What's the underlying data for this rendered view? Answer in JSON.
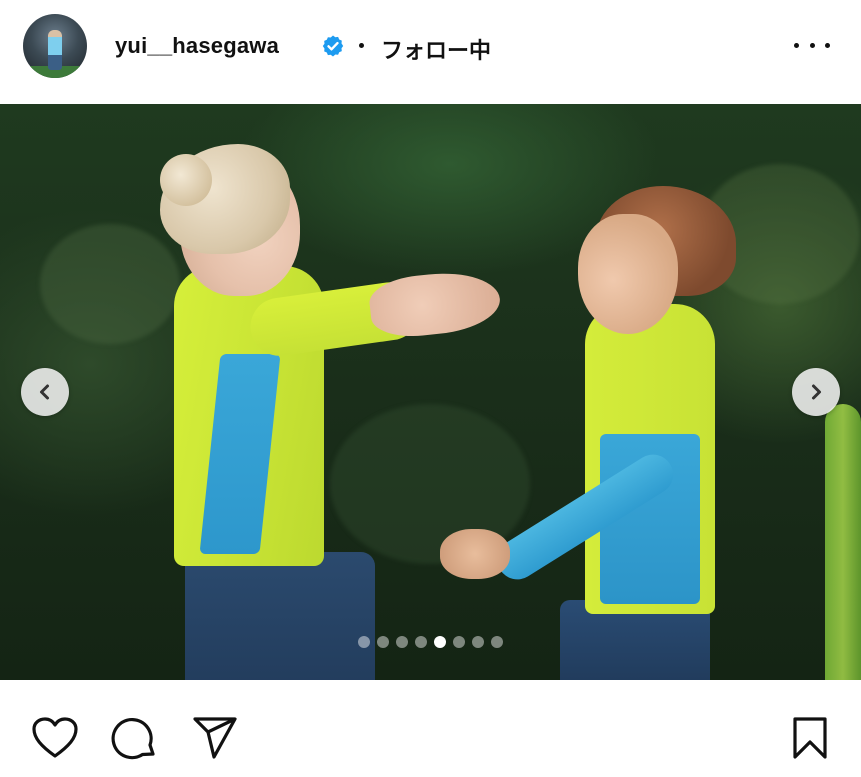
{
  "post_header": {
    "username": "yui__hasegawa",
    "verified": true,
    "separator": "•",
    "follow_status": "フォロー中",
    "more_icon": "more-horizontal-icon"
  },
  "media": {
    "description_icon_prev": "chevron-left-icon",
    "description_icon_next": "chevron-right-icon",
    "carousel_total": 8,
    "carousel_active_index": 4
  },
  "actions": {
    "like_icon": "heart-icon",
    "comment_icon": "comment-icon",
    "share_icon": "send-icon",
    "save_icon": "bookmark-icon"
  },
  "colors": {
    "verified_blue": "#1d9bf0",
    "text": "#111111",
    "dot_inactive": "rgba(255,255,255,0.45)",
    "dot_active": "#ffffff"
  }
}
